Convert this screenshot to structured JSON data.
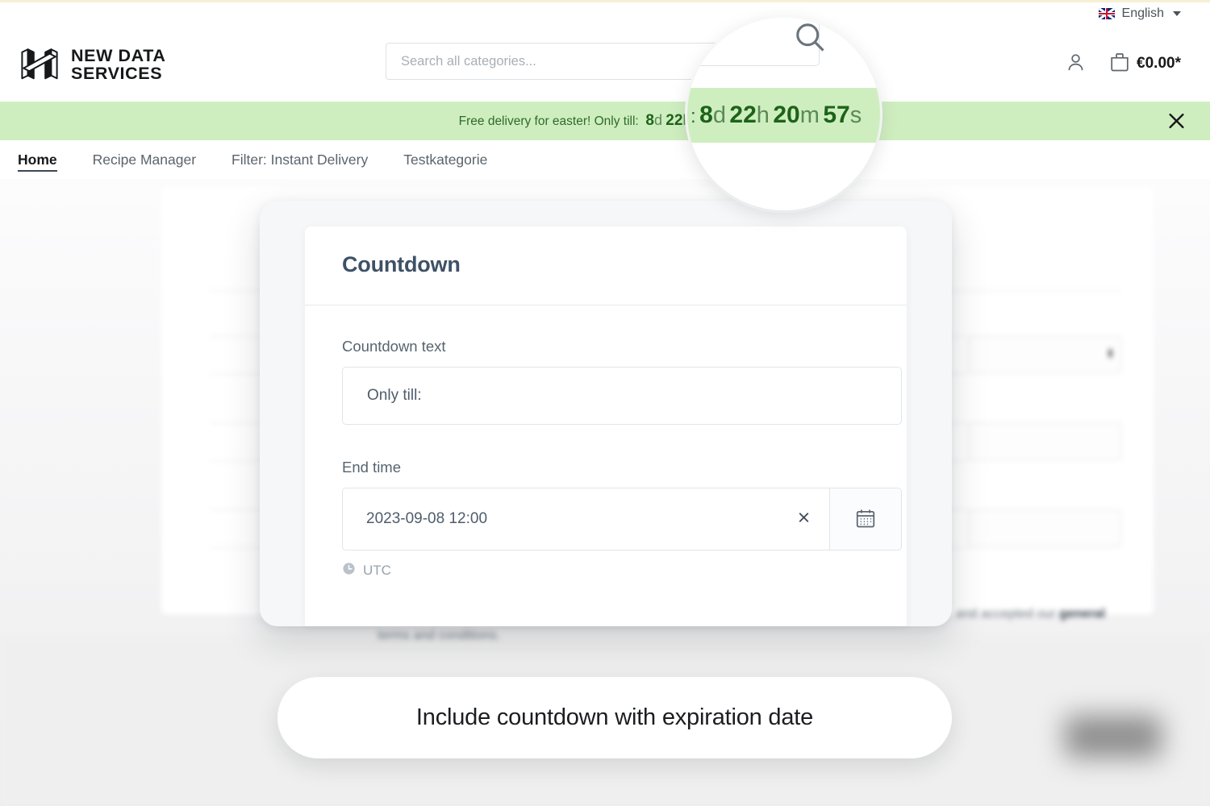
{
  "topbar": {
    "language_label": "English",
    "flag_icon": "uk-flag-icon",
    "caret_icon": "chevron-down-icon"
  },
  "header": {
    "brand_line1": "NEW DATA",
    "brand_line2": "SERVICES",
    "logo_icon": "isometric-h-logo-icon",
    "search_placeholder": "Search all categories...",
    "search_value": "",
    "search_icon": "search-icon",
    "account_icon": "person-icon",
    "cart_icon": "shopping-bag-icon",
    "cart_total": "€0.00*"
  },
  "banner": {
    "message": "Free delivery for easter! Only till:",
    "countdown": {
      "days_value": "8",
      "days_unit": "d",
      "hours_value": "22",
      "hours_unit": "h",
      "minutes_value": "20",
      "minutes_unit": "m",
      "seconds_value": "57",
      "seconds_unit": "s"
    },
    "close_icon": "close-icon",
    "background_color": "#cfeec0",
    "text_color": "#2e6b2a",
    "number_color": "#1d6318"
  },
  "nav": {
    "items": [
      {
        "label": "Home",
        "active": true
      },
      {
        "label": "Recipe Manager",
        "active": false
      },
      {
        "label": "Filter: Instant Delivery",
        "active": false
      },
      {
        "label": "Testkategorie",
        "active": false
      }
    ]
  },
  "modal": {
    "title": "Countdown",
    "countdown_text": {
      "label": "Countdown text",
      "value": "Only till:"
    },
    "end_time": {
      "label": "End time",
      "value": "2023-09-08 12:00",
      "clear_icon": "close-icon",
      "calendar_icon": "calendar-icon",
      "timezone": "UTC",
      "timezone_icon": "clock-icon"
    }
  },
  "background_page": {
    "terms_text": "terms and conditions.",
    "accepted_text_fragment": "and accepted our ",
    "accepted_text_bold": "general"
  },
  "caption": {
    "text": "Include countdown with expiration date"
  }
}
